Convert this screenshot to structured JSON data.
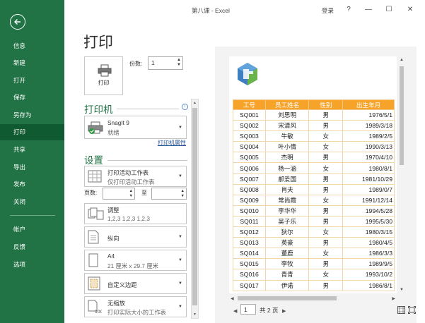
{
  "window": {
    "title": "第八课 - Excel",
    "login": "登录",
    "help": "?",
    "minimize": "—",
    "restore": "☐",
    "close": "✕"
  },
  "nav": {
    "back": "←",
    "items": [
      "信息",
      "新建",
      "打开",
      "保存",
      "另存为",
      "打印",
      "共享",
      "导出",
      "发布",
      "关闭"
    ],
    "bottom": [
      "帐户",
      "反馈",
      "选项"
    ],
    "active": "打印"
  },
  "page": {
    "title": "打印"
  },
  "print": {
    "button_label": "打印",
    "copies_label": "份数:",
    "copies_value": "1"
  },
  "printer": {
    "heading": "打印机",
    "info": "i",
    "name": "SnagIt 9",
    "status": "就绪",
    "properties_link": "打印机属性"
  },
  "settings": {
    "heading": "设置",
    "what": {
      "l1": "打印活动工作表",
      "l2": "仅打印活动工作表"
    },
    "pages_label": "页数:",
    "to_label": "至",
    "collate": {
      "l1": "调整",
      "l2": "1,2,3    1,2,3    1,2,3"
    },
    "orientation": {
      "l1": "纵向"
    },
    "paper": {
      "l1": "A4",
      "l2": "21 厘米 x 29.7 厘米"
    },
    "margins": {
      "l1": "自定义边距"
    },
    "scaling": {
      "l1": "无缩放",
      "l2": "打印实际大小的工作表"
    }
  },
  "sheet": {
    "headers": [
      "工号",
      "员工姓名",
      "性别",
      "出生年月"
    ],
    "rows": [
      [
        "SQ001",
        "刘思明",
        "男",
        "1976/5/1"
      ],
      [
        "SQ002",
        "宋清风",
        "男",
        "1989/3/18"
      ],
      [
        "SQ003",
        "牛敏",
        "女",
        "1989/2/5"
      ],
      [
        "SQ004",
        "叶小倩",
        "女",
        "1990/3/13"
      ],
      [
        "SQ005",
        "杰明",
        "男",
        "1970/4/10"
      ],
      [
        "SQ006",
        "杨一涵",
        "女",
        "1980/8/1"
      ],
      [
        "SQ007",
        "郝爱国",
        "男",
        "1981/10/29"
      ],
      [
        "SQ008",
        "肖夫",
        "男",
        "1989/0/7"
      ],
      [
        "SQ009",
        "常尚霞",
        "女",
        "1991/12/14"
      ],
      [
        "SQ010",
        "李华华",
        "男",
        "1994/5/28"
      ],
      [
        "SQ011",
        "吴子乐",
        "男",
        "1995/5/30"
      ],
      [
        "SQ012",
        "狄尔",
        "女",
        "1980/3/15"
      ],
      [
        "SQ013",
        "英豪",
        "男",
        "1980/4/5"
      ],
      [
        "SQ014",
        "董鹿",
        "女",
        "1986/3/3"
      ],
      [
        "SQ015",
        "李牧",
        "男",
        "1989/9/5"
      ],
      [
        "SQ016",
        "青青",
        "女",
        "1993/10/2"
      ],
      [
        "SQ017",
        "伊诺",
        "男",
        "1986/8/1"
      ]
    ]
  },
  "pager": {
    "prev": "◀",
    "page": "1",
    "total": "共 2 页",
    "next": "▶"
  },
  "colors": {
    "nav_green": "#217346",
    "header_orange": "#f7a32a"
  }
}
